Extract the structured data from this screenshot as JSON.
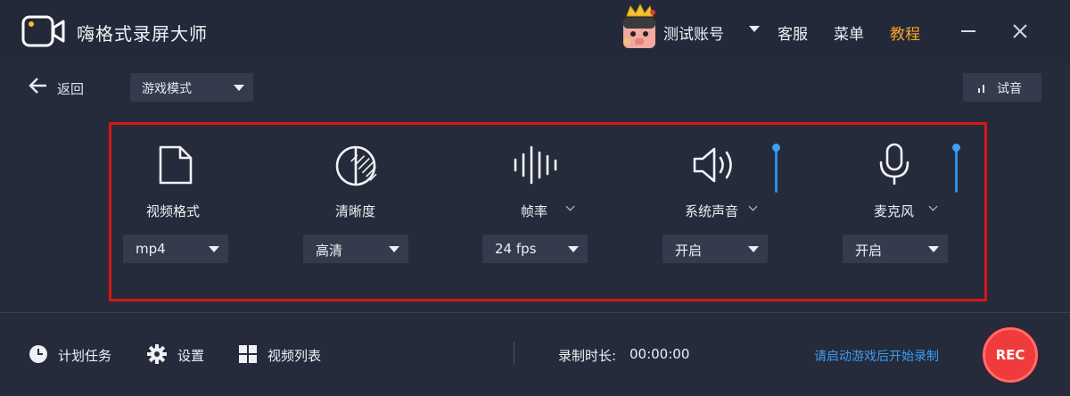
{
  "app": {
    "title": "嗨格式录屏大师"
  },
  "header": {
    "account_name": "测试账号",
    "service": "客服",
    "menu": "菜单",
    "tutorial": "教程"
  },
  "toolbar": {
    "back_label": "返回",
    "mode_value": "游戏模式",
    "test_audio_label": "试音"
  },
  "settings": {
    "video_format": {
      "label": "视频格式",
      "value": "mp4",
      "icon": "file-icon"
    },
    "clarity": {
      "label": "清晰度",
      "value": "高清",
      "icon": "contrast-icon"
    },
    "frame_rate": {
      "label": "帧率",
      "value": "24 fps",
      "icon": "waveform-icon"
    },
    "system_audio": {
      "label": "系统声音",
      "value": "开启",
      "icon": "speaker-icon",
      "level": 1.0
    },
    "microphone": {
      "label": "麦克风",
      "value": "开启",
      "icon": "microphone-icon",
      "level": 1.0
    }
  },
  "footer": {
    "schedule_label": "计划任务",
    "settings_label": "设置",
    "video_list_label": "视频列表",
    "duration_label": "录制时长:",
    "duration_value": "00:00:00",
    "hint": "请启动游戏后开始录制",
    "rec_label": "REC"
  },
  "colors": {
    "background": "#252b3a",
    "accent_blue": "#3d9bf0",
    "tutorial_orange": "#f6a623",
    "highlight_red": "#d81616",
    "rec_red": "#ef3b3b"
  }
}
